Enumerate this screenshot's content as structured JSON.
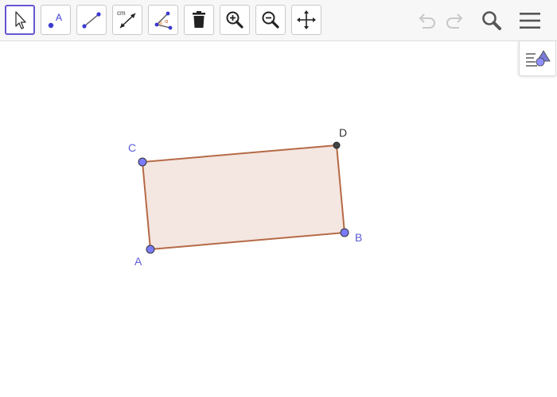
{
  "toolbar": {
    "tools": [
      {
        "icon": "move-arrow-icon",
        "selected": true
      },
      {
        "icon": "point-icon",
        "text": "A"
      },
      {
        "icon": "segment-icon"
      },
      {
        "icon": "segment-fixed-length-icon",
        "text": "cm"
      },
      {
        "icon": "angle-icon",
        "text": "α"
      },
      {
        "icon": "delete-trash-icon"
      },
      {
        "icon": "zoom-in-icon"
      },
      {
        "icon": "zoom-out-icon"
      },
      {
        "icon": "move-graphics-view-icon"
      }
    ],
    "undo": {
      "icon": "undo-icon",
      "enabled": false
    },
    "redo": {
      "icon": "redo-icon",
      "enabled": false
    },
    "search": {
      "icon": "search-icon"
    },
    "menu": {
      "icon": "hamburger-menu-icon"
    }
  },
  "algebra_toggle": {
    "icon": "algebra-view-toggle-icon"
  },
  "colors": {
    "accent": "#6557d2",
    "free_point": "#7b7bff",
    "free_label": "#5b5bd6",
    "dependent_point": "#444444",
    "dependent_label": "#333333",
    "polygon_stroke": "#b56a46",
    "polygon_fill": "#f4e6e1"
  },
  "geometry": {
    "points": [
      {
        "name": "A",
        "type": "free"
      },
      {
        "name": "B",
        "type": "free"
      },
      {
        "name": "C",
        "type": "free"
      },
      {
        "name": "D",
        "type": "dependent"
      }
    ],
    "polygon": {
      "vertices": [
        "A",
        "B",
        "D",
        "C"
      ]
    }
  }
}
